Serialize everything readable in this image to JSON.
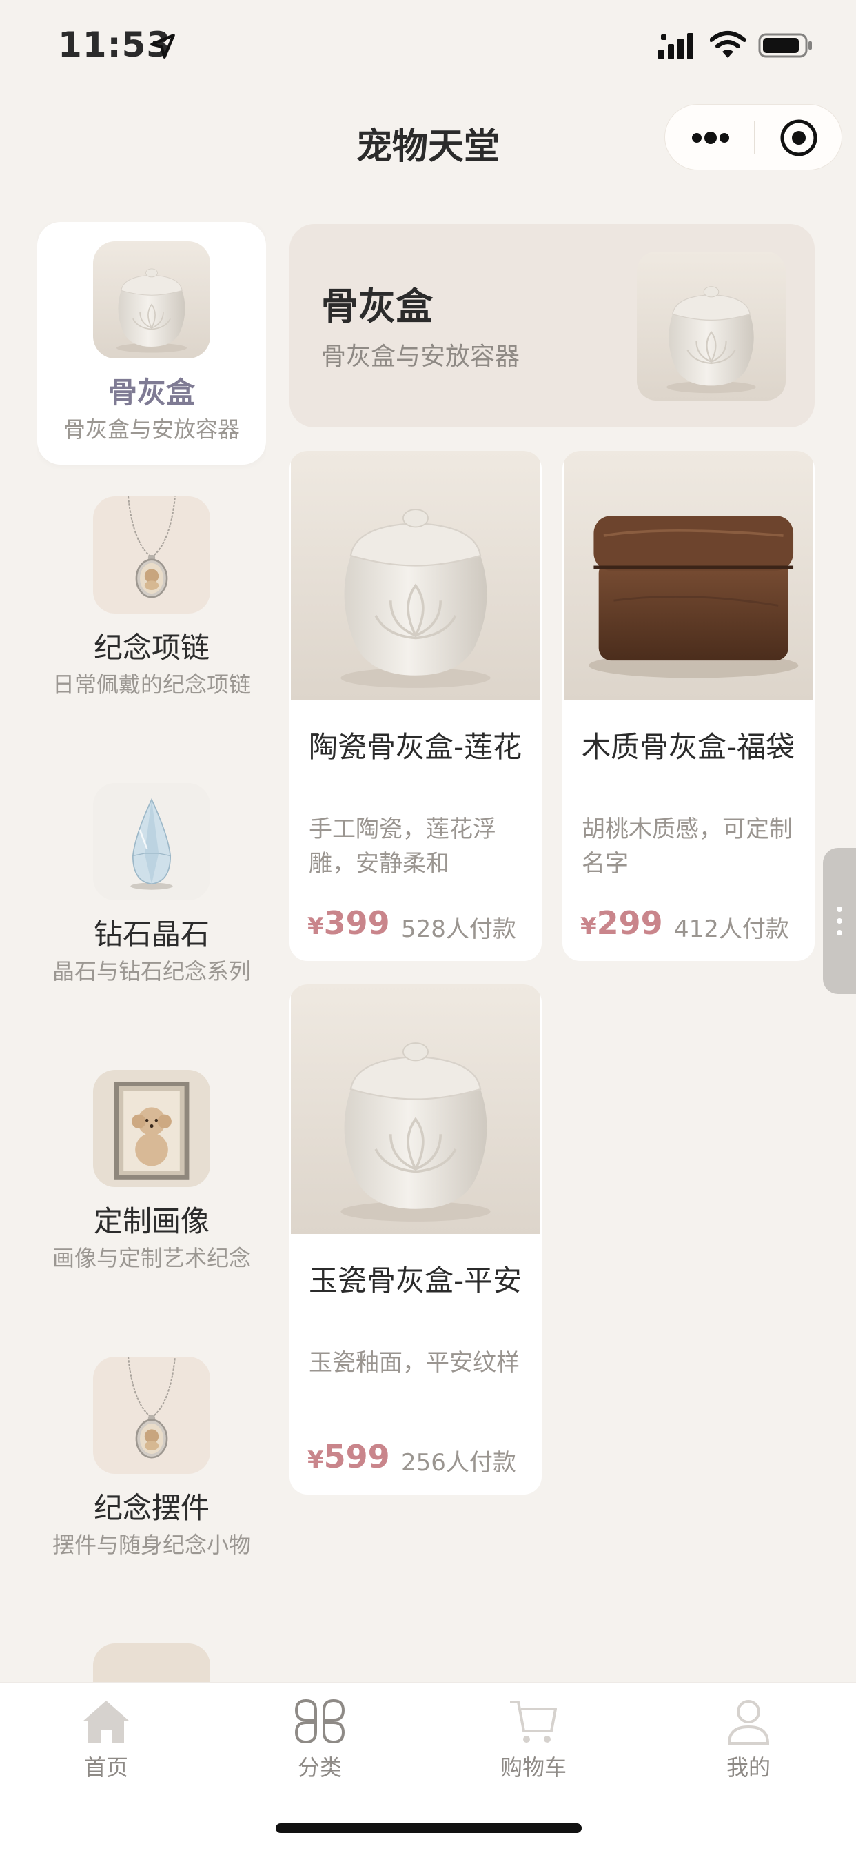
{
  "status_bar": {
    "time": "11:53"
  },
  "nav": {
    "title": "宠物天堂"
  },
  "sidebar": {
    "items": [
      {
        "name": "骨灰盒",
        "desc": "骨灰盒与安放容器",
        "active": true
      },
      {
        "name": "纪念项链",
        "desc": "日常佩戴的纪念项链"
      },
      {
        "name": "钻石晶石",
        "desc": "晶石与钻石纪念系列"
      },
      {
        "name": "定制画像",
        "desc": "画像与定制艺术纪念"
      },
      {
        "name": "纪念摆件",
        "desc": "摆件与随身纪念小物"
      }
    ]
  },
  "banner": {
    "title": "骨灰盒",
    "subtitle": "骨灰盒与安放容器"
  },
  "products": [
    {
      "title": "陶瓷骨灰盒-莲花",
      "desc": "手工陶瓷，莲花浮雕，安静柔和",
      "currency": "¥",
      "price": "399",
      "sold": "528人付款"
    },
    {
      "title": "木质骨灰盒-福袋",
      "desc": "胡桃木质感，可定制名字",
      "currency": "¥",
      "price": "299",
      "sold": "412人付款"
    },
    {
      "title": "玉瓷骨灰盒-平安",
      "desc": "玉瓷釉面，平安纹样",
      "currency": "¥",
      "price": "599",
      "sold": "256人付款"
    }
  ],
  "tabbar": {
    "items": [
      {
        "label": "首页",
        "icon": "home-icon"
      },
      {
        "label": "分类",
        "icon": "category-icon"
      },
      {
        "label": "购物车",
        "icon": "cart-icon"
      },
      {
        "label": "我的",
        "icon": "user-icon"
      }
    ]
  },
  "colors": {
    "accent_price": "#c9858b",
    "active_category": "#7f7b94",
    "background": "#f5f2ee"
  }
}
